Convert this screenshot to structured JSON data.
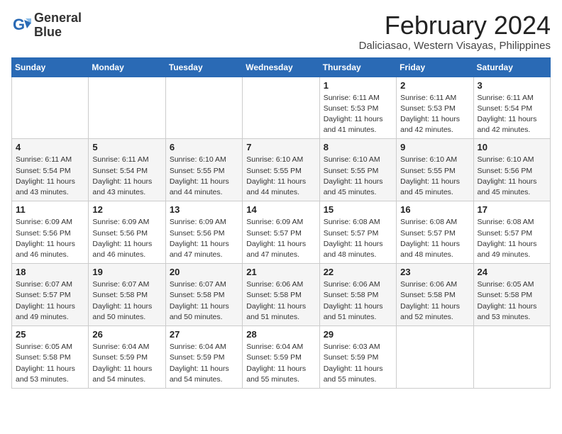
{
  "header": {
    "logo_line1": "General",
    "logo_line2": "Blue",
    "month": "February 2024",
    "location": "Daliciasao, Western Visayas, Philippines"
  },
  "days_of_week": [
    "Sunday",
    "Monday",
    "Tuesday",
    "Wednesday",
    "Thursday",
    "Friday",
    "Saturday"
  ],
  "weeks": [
    [
      {
        "day": "",
        "info": ""
      },
      {
        "day": "",
        "info": ""
      },
      {
        "day": "",
        "info": ""
      },
      {
        "day": "",
        "info": ""
      },
      {
        "day": "1",
        "info": "Sunrise: 6:11 AM\nSunset: 5:53 PM\nDaylight: 11 hours\nand 41 minutes."
      },
      {
        "day": "2",
        "info": "Sunrise: 6:11 AM\nSunset: 5:53 PM\nDaylight: 11 hours\nand 42 minutes."
      },
      {
        "day": "3",
        "info": "Sunrise: 6:11 AM\nSunset: 5:54 PM\nDaylight: 11 hours\nand 42 minutes."
      }
    ],
    [
      {
        "day": "4",
        "info": "Sunrise: 6:11 AM\nSunset: 5:54 PM\nDaylight: 11 hours\nand 43 minutes."
      },
      {
        "day": "5",
        "info": "Sunrise: 6:11 AM\nSunset: 5:54 PM\nDaylight: 11 hours\nand 43 minutes."
      },
      {
        "day": "6",
        "info": "Sunrise: 6:10 AM\nSunset: 5:55 PM\nDaylight: 11 hours\nand 44 minutes."
      },
      {
        "day": "7",
        "info": "Sunrise: 6:10 AM\nSunset: 5:55 PM\nDaylight: 11 hours\nand 44 minutes."
      },
      {
        "day": "8",
        "info": "Sunrise: 6:10 AM\nSunset: 5:55 PM\nDaylight: 11 hours\nand 45 minutes."
      },
      {
        "day": "9",
        "info": "Sunrise: 6:10 AM\nSunset: 5:55 PM\nDaylight: 11 hours\nand 45 minutes."
      },
      {
        "day": "10",
        "info": "Sunrise: 6:10 AM\nSunset: 5:56 PM\nDaylight: 11 hours\nand 45 minutes."
      }
    ],
    [
      {
        "day": "11",
        "info": "Sunrise: 6:09 AM\nSunset: 5:56 PM\nDaylight: 11 hours\nand 46 minutes."
      },
      {
        "day": "12",
        "info": "Sunrise: 6:09 AM\nSunset: 5:56 PM\nDaylight: 11 hours\nand 46 minutes."
      },
      {
        "day": "13",
        "info": "Sunrise: 6:09 AM\nSunset: 5:56 PM\nDaylight: 11 hours\nand 47 minutes."
      },
      {
        "day": "14",
        "info": "Sunrise: 6:09 AM\nSunset: 5:57 PM\nDaylight: 11 hours\nand 47 minutes."
      },
      {
        "day": "15",
        "info": "Sunrise: 6:08 AM\nSunset: 5:57 PM\nDaylight: 11 hours\nand 48 minutes."
      },
      {
        "day": "16",
        "info": "Sunrise: 6:08 AM\nSunset: 5:57 PM\nDaylight: 11 hours\nand 48 minutes."
      },
      {
        "day": "17",
        "info": "Sunrise: 6:08 AM\nSunset: 5:57 PM\nDaylight: 11 hours\nand 49 minutes."
      }
    ],
    [
      {
        "day": "18",
        "info": "Sunrise: 6:07 AM\nSunset: 5:57 PM\nDaylight: 11 hours\nand 49 minutes."
      },
      {
        "day": "19",
        "info": "Sunrise: 6:07 AM\nSunset: 5:58 PM\nDaylight: 11 hours\nand 50 minutes."
      },
      {
        "day": "20",
        "info": "Sunrise: 6:07 AM\nSunset: 5:58 PM\nDaylight: 11 hours\nand 50 minutes."
      },
      {
        "day": "21",
        "info": "Sunrise: 6:06 AM\nSunset: 5:58 PM\nDaylight: 11 hours\nand 51 minutes."
      },
      {
        "day": "22",
        "info": "Sunrise: 6:06 AM\nSunset: 5:58 PM\nDaylight: 11 hours\nand 51 minutes."
      },
      {
        "day": "23",
        "info": "Sunrise: 6:06 AM\nSunset: 5:58 PM\nDaylight: 11 hours\nand 52 minutes."
      },
      {
        "day": "24",
        "info": "Sunrise: 6:05 AM\nSunset: 5:58 PM\nDaylight: 11 hours\nand 53 minutes."
      }
    ],
    [
      {
        "day": "25",
        "info": "Sunrise: 6:05 AM\nSunset: 5:58 PM\nDaylight: 11 hours\nand 53 minutes."
      },
      {
        "day": "26",
        "info": "Sunrise: 6:04 AM\nSunset: 5:59 PM\nDaylight: 11 hours\nand 54 minutes."
      },
      {
        "day": "27",
        "info": "Sunrise: 6:04 AM\nSunset: 5:59 PM\nDaylight: 11 hours\nand 54 minutes."
      },
      {
        "day": "28",
        "info": "Sunrise: 6:04 AM\nSunset: 5:59 PM\nDaylight: 11 hours\nand 55 minutes."
      },
      {
        "day": "29",
        "info": "Sunrise: 6:03 AM\nSunset: 5:59 PM\nDaylight: 11 hours\nand 55 minutes."
      },
      {
        "day": "",
        "info": ""
      },
      {
        "day": "",
        "info": ""
      }
    ]
  ]
}
